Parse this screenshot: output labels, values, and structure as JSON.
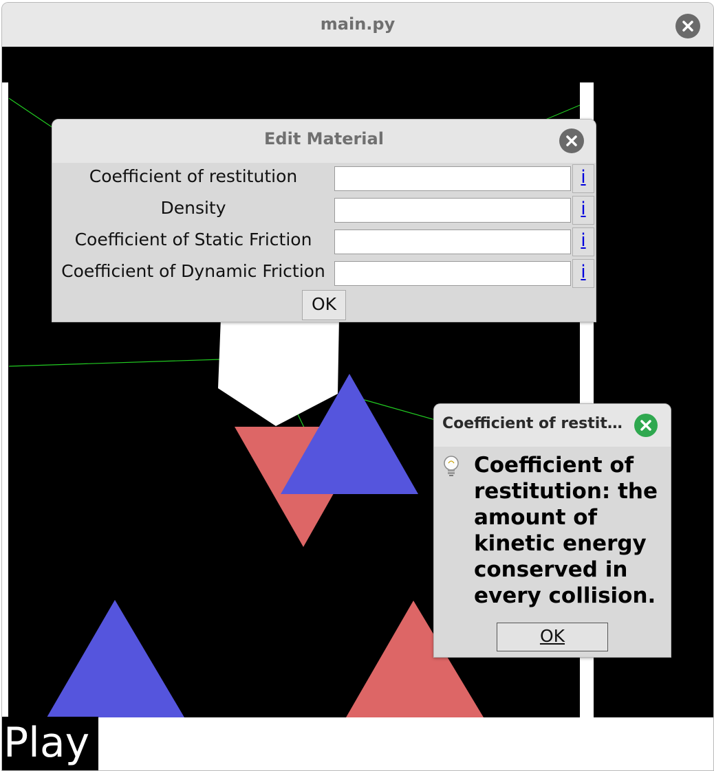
{
  "window": {
    "title": "main.py"
  },
  "toolbar": {
    "play_label": "Play"
  },
  "edit_material": {
    "title": "Edit Material",
    "fields": [
      {
        "label": "Coefficient of restitution",
        "value": "",
        "info_label": "i"
      },
      {
        "label": "Density",
        "value": "",
        "info_label": "i"
      },
      {
        "label": "Coefficient of Static Friction",
        "value": "",
        "info_label": "i"
      },
      {
        "label": "Coefficient of Dynamic Friction",
        "value": "",
        "info_label": "i"
      }
    ],
    "ok_label": "OK"
  },
  "info_popup": {
    "title": "Coefficient of restit…",
    "message": "Coefficient of restitution: the amount of kinetic energy conserved in every collision.",
    "ok_label": "OK",
    "icon": "lightbulb-icon"
  },
  "scene": {
    "background_color": "#000000",
    "wall_color": "#ffffff",
    "link_color": "#22cc22",
    "triangle_blue": "#5555dd",
    "triangle_red": "#dd6666",
    "polygon_white": "#ffffff"
  }
}
